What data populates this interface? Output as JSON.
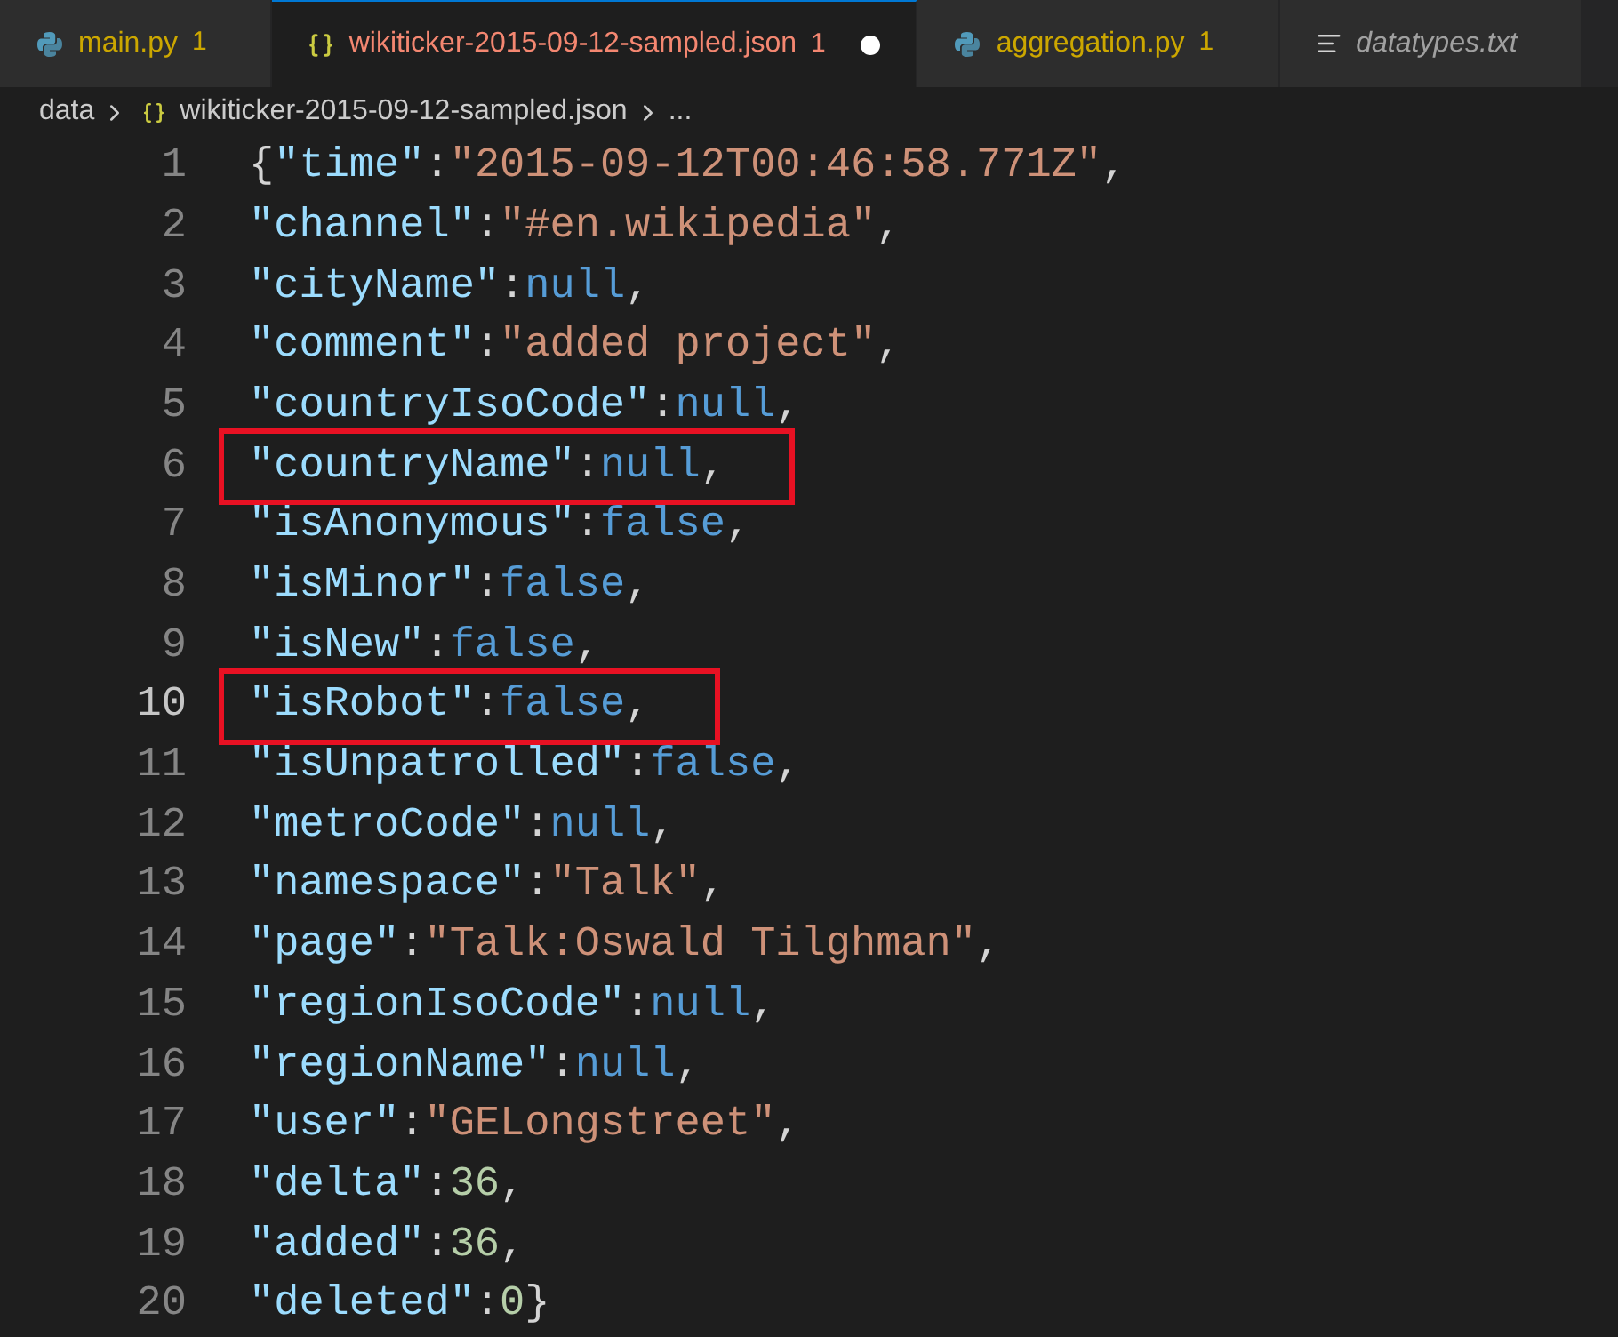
{
  "tabs": [
    {
      "label": "main.py",
      "kind": "python",
      "problems": "1",
      "color": "#cca700",
      "selected": false,
      "modified": false,
      "preview": false
    },
    {
      "label": "wikiticker-2015-09-12-sampled.json",
      "kind": "json",
      "problems": "1",
      "color": "#f48771",
      "selected": true,
      "modified": true,
      "preview": false
    },
    {
      "label": "aggregation.py",
      "kind": "python",
      "problems": "1",
      "color": "#cca700",
      "selected": false,
      "modified": false,
      "preview": false
    },
    {
      "label": "datatypes.txt",
      "kind": "text",
      "color": "#a0a0a0",
      "selected": false,
      "modified": false,
      "preview": true
    }
  ],
  "breadcrumb": [
    {
      "label": "data",
      "kind": "folder"
    },
    {
      "label": "wikiticker-2015-09-12-sampled.json",
      "kind": "json"
    },
    {
      "label": "...",
      "kind": "more"
    }
  ],
  "lines": [
    {
      "number": "1",
      "current": false,
      "highlighted": false,
      "tokens": [
        {
          "kind": "punct",
          "text": "{"
        },
        {
          "kind": "key",
          "text": "\"time\""
        },
        {
          "kind": "punct",
          "text": ":"
        },
        {
          "kind": "string",
          "text": "\"2015-09-12T00:46:58.771Z\""
        },
        {
          "kind": "punct",
          "text": ","
        }
      ]
    },
    {
      "number": "2",
      "current": false,
      "highlighted": false,
      "tokens": [
        {
          "kind": "key",
          "text": "\"channel\""
        },
        {
          "kind": "punct",
          "text": ":"
        },
        {
          "kind": "string",
          "text": "\"#en.wikipedia\""
        },
        {
          "kind": "punct",
          "text": ","
        }
      ]
    },
    {
      "number": "3",
      "current": false,
      "highlighted": false,
      "tokens": [
        {
          "kind": "key",
          "text": "\"cityName\""
        },
        {
          "kind": "punct",
          "text": ":"
        },
        {
          "kind": "keyword",
          "text": "null"
        },
        {
          "kind": "punct",
          "text": ","
        }
      ]
    },
    {
      "number": "4",
      "current": false,
      "highlighted": false,
      "tokens": [
        {
          "kind": "key",
          "text": "\"comment\""
        },
        {
          "kind": "punct",
          "text": ":"
        },
        {
          "kind": "string",
          "text": "\"added project\""
        },
        {
          "kind": "punct",
          "text": ","
        }
      ]
    },
    {
      "number": "5",
      "current": false,
      "highlighted": false,
      "tokens": [
        {
          "kind": "key",
          "text": "\"countryIsoCode\""
        },
        {
          "kind": "punct",
          "text": ":"
        },
        {
          "kind": "keyword",
          "text": "null"
        },
        {
          "kind": "punct",
          "text": ","
        }
      ]
    },
    {
      "number": "6",
      "current": false,
      "highlighted": true,
      "tokens": [
        {
          "kind": "key",
          "text": "\"countryName\""
        },
        {
          "kind": "punct",
          "text": ":"
        },
        {
          "kind": "keyword",
          "text": "null"
        },
        {
          "kind": "punct",
          "text": ","
        }
      ]
    },
    {
      "number": "7",
      "current": false,
      "highlighted": false,
      "tokens": [
        {
          "kind": "key",
          "text": "\"isAnonymous\""
        },
        {
          "kind": "punct",
          "text": ":"
        },
        {
          "kind": "keyword",
          "text": "false"
        },
        {
          "kind": "punct",
          "text": ","
        }
      ]
    },
    {
      "number": "8",
      "current": false,
      "highlighted": false,
      "tokens": [
        {
          "kind": "key",
          "text": "\"isMinor\""
        },
        {
          "kind": "punct",
          "text": ":"
        },
        {
          "kind": "keyword",
          "text": "false"
        },
        {
          "kind": "punct",
          "text": ","
        }
      ]
    },
    {
      "number": "9",
      "current": false,
      "highlighted": false,
      "tokens": [
        {
          "kind": "key",
          "text": "\"isNew\""
        },
        {
          "kind": "punct",
          "text": ":"
        },
        {
          "kind": "keyword",
          "text": "false"
        },
        {
          "kind": "punct",
          "text": ","
        }
      ]
    },
    {
      "number": "10",
      "current": true,
      "highlighted": true,
      "tokens": [
        {
          "kind": "key",
          "text": "\"isRobot\""
        },
        {
          "kind": "punct",
          "text": ":"
        },
        {
          "kind": "keyword",
          "text": "false"
        },
        {
          "kind": "punct",
          "text": ","
        }
      ]
    },
    {
      "number": "11",
      "current": false,
      "highlighted": false,
      "tokens": [
        {
          "kind": "key",
          "text": "\"isUnpatrolled\""
        },
        {
          "kind": "punct",
          "text": ":"
        },
        {
          "kind": "keyword",
          "text": "false"
        },
        {
          "kind": "punct",
          "text": ","
        }
      ]
    },
    {
      "number": "12",
      "current": false,
      "highlighted": false,
      "tokens": [
        {
          "kind": "key",
          "text": "\"metroCode\""
        },
        {
          "kind": "punct",
          "text": ":"
        },
        {
          "kind": "keyword",
          "text": "null"
        },
        {
          "kind": "punct",
          "text": ","
        }
      ]
    },
    {
      "number": "13",
      "current": false,
      "highlighted": false,
      "tokens": [
        {
          "kind": "key",
          "text": "\"namespace\""
        },
        {
          "kind": "punct",
          "text": ":"
        },
        {
          "kind": "string",
          "text": "\"Talk\""
        },
        {
          "kind": "punct",
          "text": ","
        }
      ]
    },
    {
      "number": "14",
      "current": false,
      "highlighted": false,
      "tokens": [
        {
          "kind": "key",
          "text": "\"page\""
        },
        {
          "kind": "punct",
          "text": ":"
        },
        {
          "kind": "string",
          "text": "\"Talk:Oswald Tilghman\""
        },
        {
          "kind": "punct",
          "text": ","
        }
      ]
    },
    {
      "number": "15",
      "current": false,
      "highlighted": false,
      "tokens": [
        {
          "kind": "key",
          "text": "\"regionIsoCode\""
        },
        {
          "kind": "punct",
          "text": ":"
        },
        {
          "kind": "keyword",
          "text": "null"
        },
        {
          "kind": "punct",
          "text": ","
        }
      ]
    },
    {
      "number": "16",
      "current": false,
      "highlighted": false,
      "tokens": [
        {
          "kind": "key",
          "text": "\"regionName\""
        },
        {
          "kind": "punct",
          "text": ":"
        },
        {
          "kind": "keyword",
          "text": "null"
        },
        {
          "kind": "punct",
          "text": ","
        }
      ]
    },
    {
      "number": "17",
      "current": false,
      "highlighted": false,
      "tokens": [
        {
          "kind": "key",
          "text": "\"user\""
        },
        {
          "kind": "punct",
          "text": ":"
        },
        {
          "kind": "string",
          "text": "\"GELongstreet\""
        },
        {
          "kind": "punct",
          "text": ","
        }
      ]
    },
    {
      "number": "18",
      "current": false,
      "highlighted": false,
      "tokens": [
        {
          "kind": "key",
          "text": "\"delta\""
        },
        {
          "kind": "punct",
          "text": ":"
        },
        {
          "kind": "number",
          "text": "36"
        },
        {
          "kind": "punct",
          "text": ","
        }
      ]
    },
    {
      "number": "19",
      "current": false,
      "highlighted": false,
      "tokens": [
        {
          "kind": "key",
          "text": "\"added\""
        },
        {
          "kind": "punct",
          "text": ":"
        },
        {
          "kind": "number",
          "text": "36"
        },
        {
          "kind": "punct",
          "text": ","
        }
      ]
    },
    {
      "number": "20",
      "current": false,
      "highlighted": false,
      "tokens": [
        {
          "kind": "key",
          "text": "\"deleted\""
        },
        {
          "kind": "punct",
          "text": ":"
        },
        {
          "kind": "number",
          "text": "0"
        },
        {
          "kind": "punct",
          "text": "}"
        }
      ]
    }
  ]
}
